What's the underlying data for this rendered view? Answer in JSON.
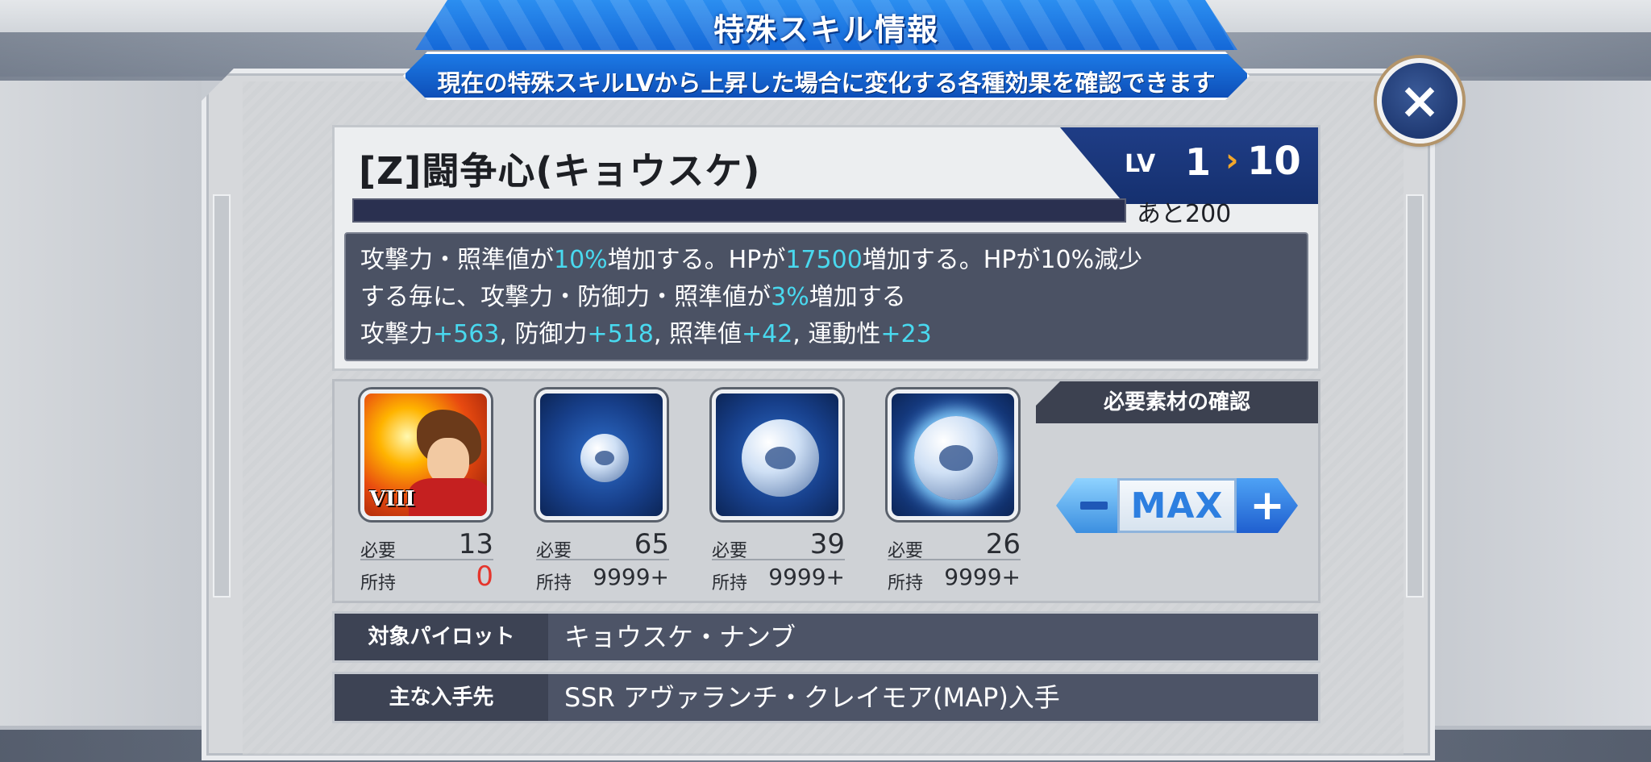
{
  "dialog": {
    "title": "特殊スキル情報",
    "subtitle": "現在の特殊スキルLVから上昇した場合に変化する各種効果を確認できます",
    "close_label": "×"
  },
  "skill": {
    "name": "[Z]闘争心(キョウスケ)",
    "lv_label": "LV",
    "lv_current": "1",
    "lv_target": "10",
    "exp_remaining": "あと200",
    "exp_progress_fraction": 0,
    "description": {
      "line1": [
        "攻撃力・照準値が",
        "10%",
        "増加する。HPが",
        "17500",
        "増加する。HPが10%減少"
      ],
      "line2": [
        "する毎に、攻撃力・防御力・照準値が",
        "3%",
        "増加する"
      ],
      "line3": [
        "攻撃力",
        "+563",
        ", 防御力",
        "+518",
        ", 照準値",
        "+42",
        ", 運動性",
        "+23"
      ]
    }
  },
  "materials": {
    "header": "必要素材の確認",
    "need_label": "必要",
    "own_label": "所持",
    "items": [
      {
        "icon": "pilot-kyosuke-icon",
        "rank": "VIII",
        "need": "13",
        "own": "0"
      },
      {
        "icon": "small-orb-icon",
        "need": "65",
        "own": "9999+"
      },
      {
        "icon": "medium-orb-icon",
        "need": "39",
        "own": "9999+"
      },
      {
        "icon": "large-orb-icon",
        "need": "26",
        "own": "9999+"
      }
    ],
    "stepper": {
      "minus": "−",
      "max": "MAX",
      "plus": "+"
    }
  },
  "info": {
    "target_pilot_label": "対象パイロット",
    "target_pilot_value": "キョウスケ・ナンブ",
    "source_label": "主な入手先",
    "source_value": "SSR アヴァランチ・クレイモア(MAP)入手"
  },
  "colors": {
    "highlight": "#49d9ef",
    "zero_warning": "#e5352c",
    "banner_blue": "#1468d8",
    "panel_dark": "#4b5264"
  }
}
